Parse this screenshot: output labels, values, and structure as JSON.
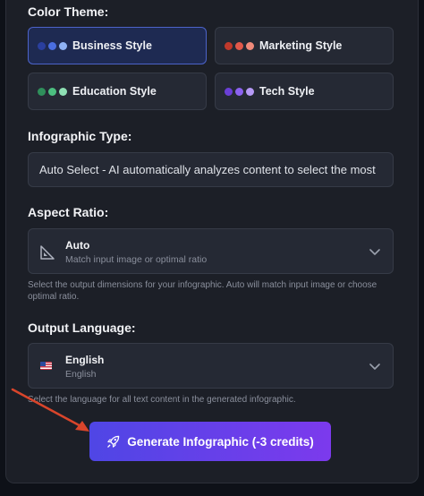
{
  "color_theme": {
    "label": "Color Theme:",
    "options": [
      {
        "label": "Business Style",
        "selected": true,
        "colors": [
          "#2a3f9e",
          "#4a6ee0",
          "#8fb2f5"
        ]
      },
      {
        "label": "Marketing Style",
        "selected": false,
        "colors": [
          "#c0392b",
          "#e2584a",
          "#f08a7a"
        ]
      },
      {
        "label": "Education Style",
        "selected": false,
        "colors": [
          "#2f8f5b",
          "#4cbf80",
          "#8ee0b4"
        ]
      },
      {
        "label": "Tech Style",
        "selected": false,
        "colors": [
          "#6a3fd6",
          "#8c62f0",
          "#b69af7"
        ]
      }
    ]
  },
  "infographic_type": {
    "label": "Infographic Type:",
    "value": "Auto Select - AI automatically analyzes content to select the most"
  },
  "aspect_ratio": {
    "label": "Aspect Ratio:",
    "value_title": "Auto",
    "value_subtitle": "Match input image or optimal ratio",
    "help": "Select the output dimensions for your infographic. Auto will match input image or choose optimal ratio."
  },
  "output_language": {
    "label": "Output Language:",
    "value_title": "English",
    "value_subtitle": "English",
    "help": "Select the language for all text content in the generated infographic."
  },
  "generate_button": {
    "label": "Generate Infographic (-3 credits)"
  },
  "icons": {
    "ratio": "set-square-icon",
    "language": "us-flag-icon",
    "chevron": "chevron-down-icon",
    "button": "rocket-icon",
    "annotation": "red-arrow-annotation"
  },
  "colors": {
    "accent": "#4f46e5",
    "accent_end": "#7c3aed",
    "annotation": "#d9452b"
  }
}
